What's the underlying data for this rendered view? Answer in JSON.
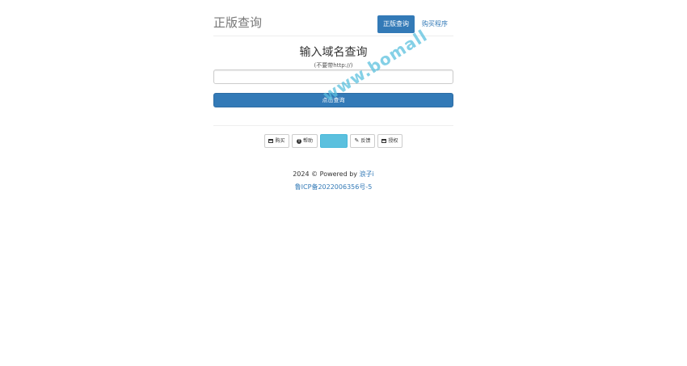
{
  "header": {
    "title": "正版查询",
    "nav": [
      {
        "label": "正版查询",
        "active": true
      },
      {
        "label": "购买程序",
        "active": false
      }
    ]
  },
  "query": {
    "heading": "输入域名查询",
    "hint": "(不要带http://)",
    "input_value": "",
    "input_placeholder": "",
    "submit_label": "点击查询"
  },
  "buttons": [
    {
      "label": "购买",
      "icon": "card-icon"
    },
    {
      "label": "帮助",
      "icon": "info-icon"
    },
    {
      "label": "",
      "icon": ""
    },
    {
      "label": "反馈",
      "icon": "pencil-icon"
    },
    {
      "label": "授权",
      "icon": "card-icon"
    }
  ],
  "footer": {
    "copyright": "2024 © Powered by",
    "author": "浪子i",
    "icp": "鲁ICP备2022006356号-5"
  },
  "watermark": "www.bomall",
  "colors": {
    "primary": "#337ab7",
    "info": "#5bc0de",
    "title_gray": "#777777"
  }
}
